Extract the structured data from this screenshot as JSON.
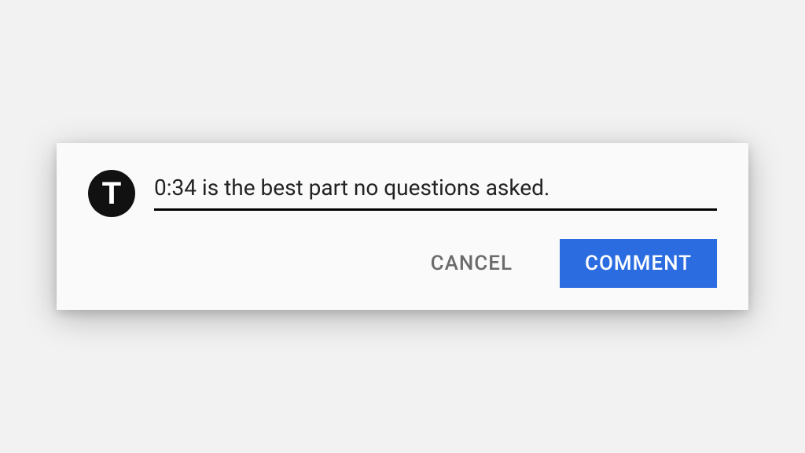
{
  "avatar": {
    "letter": "T"
  },
  "input": {
    "value": "0:34 is the best part no questions asked."
  },
  "actions": {
    "cancel_label": "CANCEL",
    "submit_label": "COMMENT"
  },
  "colors": {
    "accent": "#2b6ce0"
  }
}
